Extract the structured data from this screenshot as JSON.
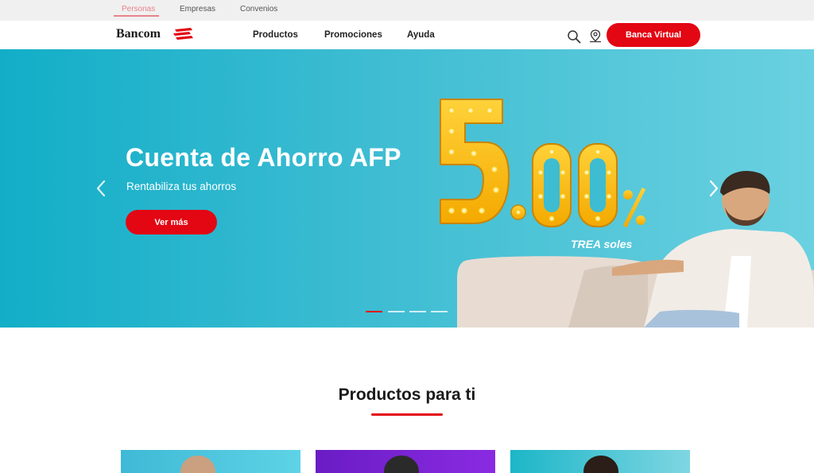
{
  "topbar": {
    "tabs": [
      {
        "label": "Personas",
        "active": true
      },
      {
        "label": "Empresas",
        "active": false
      },
      {
        "label": "Convenios",
        "active": false
      }
    ]
  },
  "header": {
    "logo_text": "Bancom",
    "nav": [
      "Productos",
      "Promociones",
      "Ayuda"
    ],
    "icons": [
      "search-icon",
      "location-icon"
    ],
    "cta_label": "Banca Virtual"
  },
  "hero": {
    "title": "Cuenta de Ahorro AFP",
    "subtitle": "Rentabiliza tus ahorros",
    "button_label": "Ver más",
    "rate": {
      "integer": "5",
      "decimals": ".00",
      "percent": "%"
    },
    "rate_caption": "TREA soles",
    "slides_total": 4,
    "active_slide": 1
  },
  "products": {
    "title": "Productos para ti"
  },
  "colors": {
    "brand_red": "#e30613",
    "hero_cyan": "#3dbcd2",
    "tab_active": "#e8838b",
    "card_purple": "#7a22d6"
  }
}
